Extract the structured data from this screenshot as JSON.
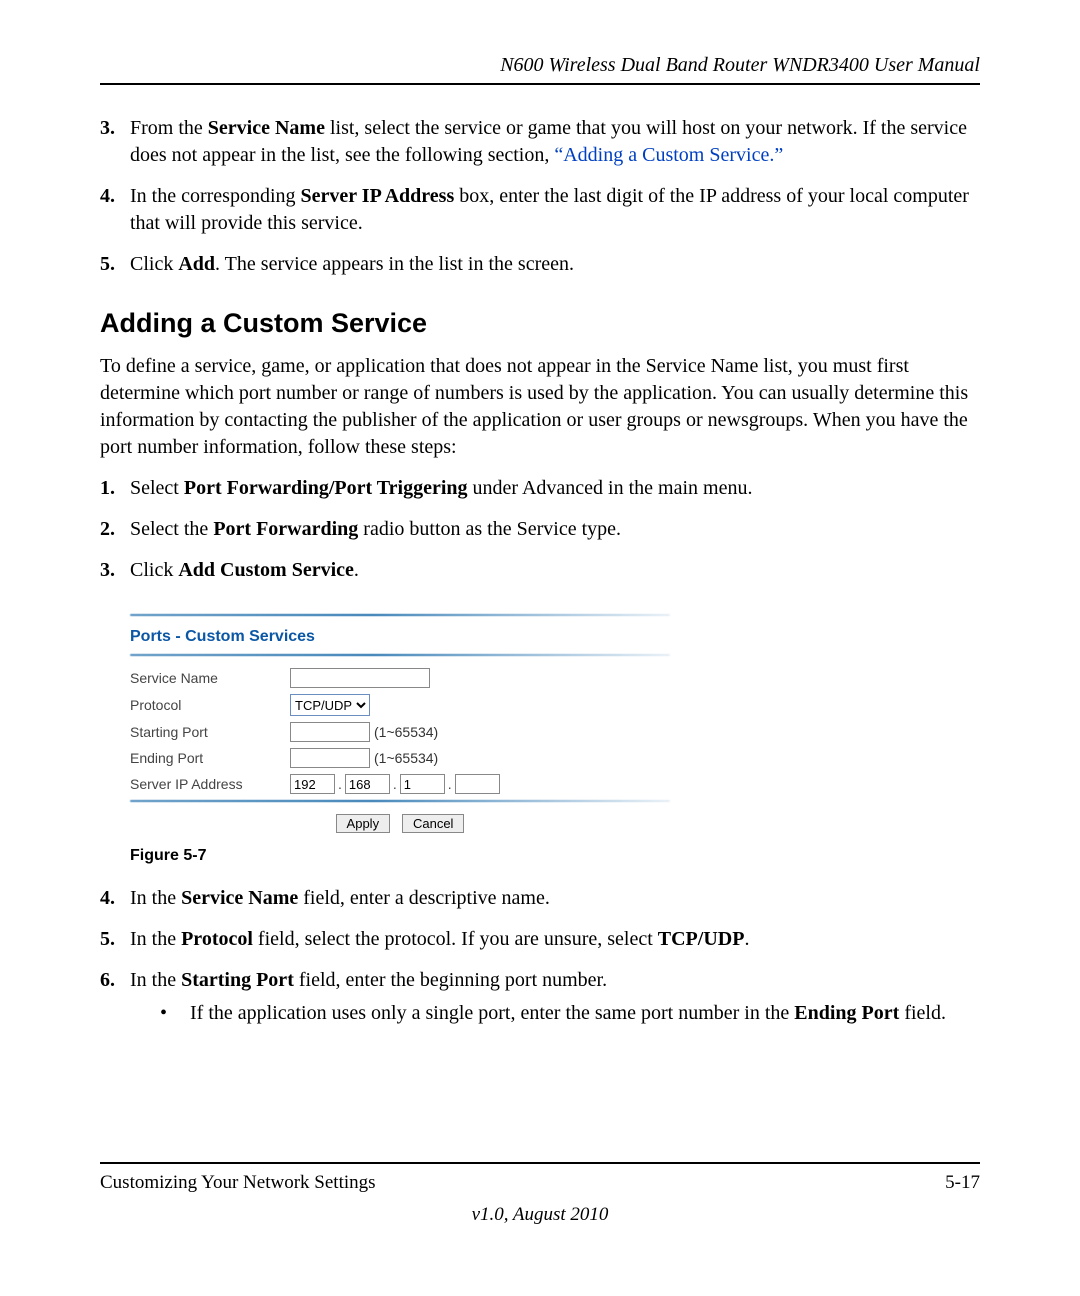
{
  "header": {
    "title": "N600 Wireless Dual Band Router WNDR3400 User Manual"
  },
  "top_steps": {
    "s3_num": "3.",
    "s3_a": "From the ",
    "s3_b": "Service Name",
    "s3_c": " list, select the service or game that you will host on your network. If the service does not appear in the list, see the following section, ",
    "s3_link": "“Adding a Custom Service.”",
    "s4_num": "4.",
    "s4_a": "In the corresponding ",
    "s4_b": "Server IP Address",
    "s4_c": " box, enter the last digit of the IP address of your local computer that will provide this service.",
    "s5_num": "5.",
    "s5_a": "Click ",
    "s5_b": "Add",
    "s5_c": ". The service appears in the list in the screen."
  },
  "section_heading": "Adding a Custom Service",
  "intro": "To define a service, game, or application that does not appear in the Service Name list, you must first determine which port number or range of numbers is used by the application. You can usually determine this information by contacting the publisher of the application or user groups or newsgroups. When you have the port number information, follow these steps:",
  "mid_steps": {
    "s1_num": "1.",
    "s1_a": "Select ",
    "s1_b": "Port Forwarding/Port Triggering",
    "s1_c": " under Advanced in the main menu.",
    "s2_num": "2.",
    "s2_a": "Select the ",
    "s2_b": "Port Forwarding",
    "s2_c": " radio button as the Service type.",
    "s3_num": "3.",
    "s3_a": "Click ",
    "s3_b": "Add Custom Service",
    "s3_c": "."
  },
  "form": {
    "title": "Ports - Custom Services",
    "rows": {
      "service_name": "Service Name",
      "protocol": "Protocol",
      "protocol_value": "TCP/UDP",
      "starting_port": "Starting Port",
      "ending_port": "Ending Port",
      "port_hint": "(1~65534)",
      "server_ip": "Server IP Address",
      "ip1": "192",
      "ip2": "168",
      "ip3": "1",
      "ip4": ""
    },
    "buttons": {
      "apply": "Apply",
      "cancel": "Cancel"
    }
  },
  "figure_caption": "Figure 5-7",
  "post_steps": {
    "s4_num": "4.",
    "s4_a": "In the ",
    "s4_b": "Service Name",
    "s4_c": " field, enter a descriptive name.",
    "s5_num": "5.",
    "s5_a": "In the ",
    "s5_b": "Protocol",
    "s5_c": " field, select the protocol. If you are unsure, select ",
    "s5_d": "TCP/UDP",
    "s5_e": ".",
    "s6_num": "6.",
    "s6_a": "In the ",
    "s6_b": "Starting Port",
    "s6_c": " field, enter the beginning port number.",
    "bullet_a": "If the application uses only a single port, enter the same port number in the ",
    "bullet_b": "Ending Port",
    "bullet_c": " field."
  },
  "footer": {
    "left": "Customizing Your Network Settings",
    "right": "5-17",
    "version": "v1.0, August 2010"
  }
}
